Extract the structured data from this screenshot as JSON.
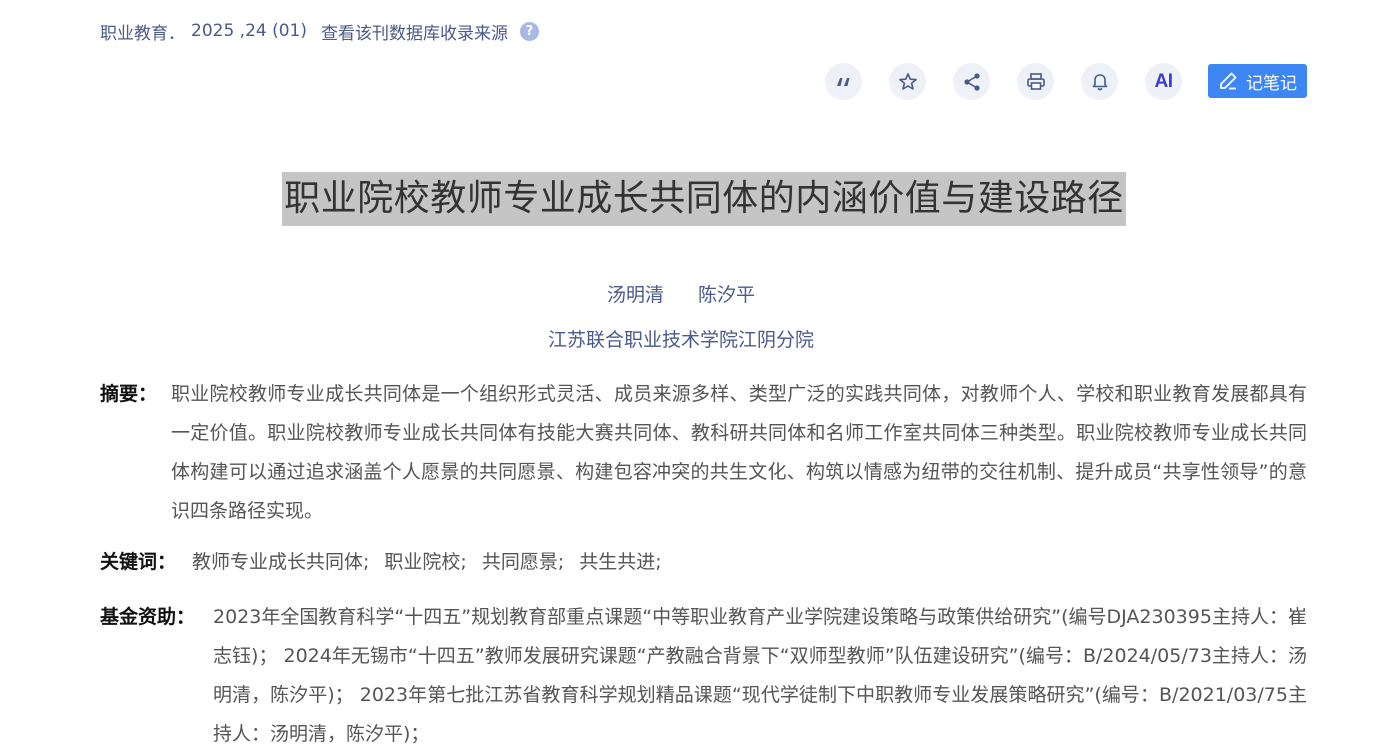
{
  "source": {
    "journal": "职业教育．",
    "issue": "2025 ,24 (01)",
    "db_link": "查看该刊数据库收录来源",
    "help_icon": "?"
  },
  "toolbar": {
    "icons": [
      "quote-icon",
      "star-icon",
      "share-icon",
      "print-icon",
      "bell-icon",
      "ai-icon"
    ],
    "ai_label": "AI",
    "note_label": "记笔记",
    "note_color": "#3f86f5"
  },
  "article": {
    "title": "职业院校教师专业成长共同体的内涵价值与建设路径",
    "authors": [
      "汤明清",
      "陈汐平"
    ],
    "affiliation": "江苏联合职业技术学院江阴分院",
    "abstract_label": "摘要：",
    "abstract": "职业院校教师专业成长共同体是一个组织形式灵活、成员来源多样、类型广泛的实践共同体，对教师个人、学校和职业教育发展都具有一定价值。职业院校教师专业成长共同体有技能大赛共同体、教科研共同体和名师工作室共同体三种类型。职业院校教师专业成长共同体构建可以通过追求涵盖个人愿景的共同愿景、构建包容冲突的共生文化、构筑以情感为纽带的交往机制、提升成员“共享性领导”的意识四条路径实现。",
    "keywords_label": "关键词：",
    "keywords": [
      "教师专业成长共同体;",
      "职业院校;",
      "共同愿景;",
      "共生共进;"
    ],
    "fund_label": "基金资助：",
    "fund": "2023年全国教育科学“十四五”规划教育部重点课题“中等职业教育产业学院建设策略与政策供给研究”(编号DJA230395主持人：崔志钰)； 2024年无锡市“十四五”教师发展研究课题“产教融合背景下“双师型教师”队伍建设研究”(编号：B/2024/05/73主持人：汤明清，陈汐平)； 2023年第七批江苏省教育科学规划精品课题“现代学徒制下中职教师专业发展策略研究”(编号：B/2021/03/75主持人：汤明清，陈汐平)；"
  }
}
